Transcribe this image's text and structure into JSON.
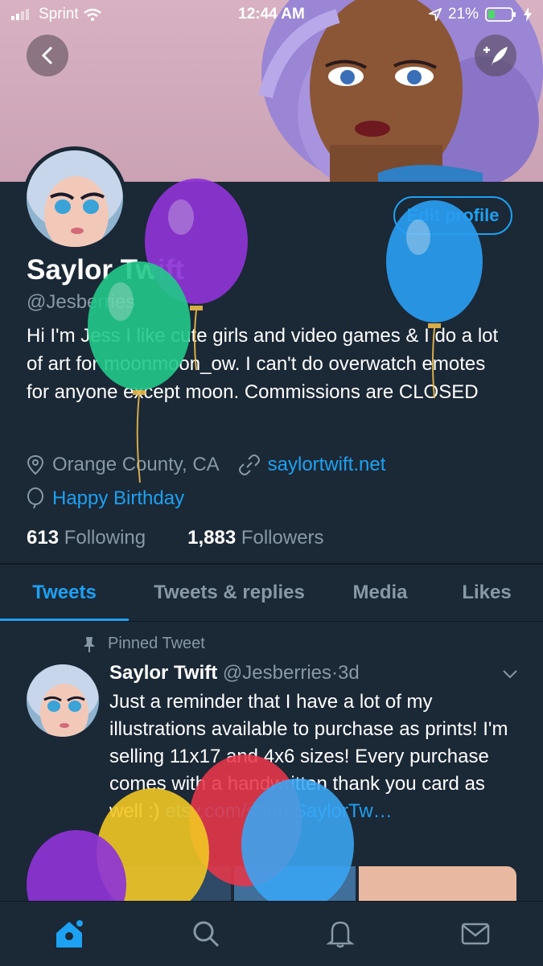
{
  "status_bar": {
    "carrier": "Sprint",
    "time": "12:44 AM",
    "battery": "21%"
  },
  "profile": {
    "name": "Saylor Twift",
    "handle": "@Jesberries",
    "bio": "Hi I'm Jess I like cute girls and video games & I do a lot of art for moonmoon_ow. I can't do overwatch emotes for anyone except moon. Commissions are CLOSED",
    "location": "Orange County, CA",
    "website": "saylortwift.net",
    "birthday": "Happy Birthday",
    "edit_label": "Edit profile",
    "following_count": "613",
    "following_label": "Following",
    "followers_count": "1,883",
    "followers_label": "Followers"
  },
  "tabs": [
    {
      "label": "Tweets",
      "active": true
    },
    {
      "label": "Tweets & replies",
      "active": false
    },
    {
      "label": "Media",
      "active": false
    },
    {
      "label": "Likes",
      "active": false
    }
  ],
  "pinned_tweet": {
    "pinned_label": "Pinned Tweet",
    "name": "Saylor Twift",
    "handle": "@Jesberries",
    "separator": "·",
    "time": "3d",
    "text": "Just a reminder that I have a lot of my illustrations available to purchase as prints! I'm selling 11x17 and 4x6 sizes! Every purchase comes with a handwritten thank you card as well :)",
    "link": "etsy.com/shop/SaylorTw…"
  },
  "icons": {
    "back": "chevron-left-icon",
    "compose": "compose-tweet-icon",
    "location": "location-pin-icon",
    "link": "link-icon",
    "birthday": "balloon-icon",
    "pin": "pin-icon",
    "more": "chevron-down-icon",
    "nav": [
      "home-icon",
      "search-icon",
      "notifications-icon",
      "messages-icon"
    ]
  },
  "colors": {
    "accent": "#1da1f2",
    "background": "#1b2836",
    "muted": "#8899a6"
  }
}
